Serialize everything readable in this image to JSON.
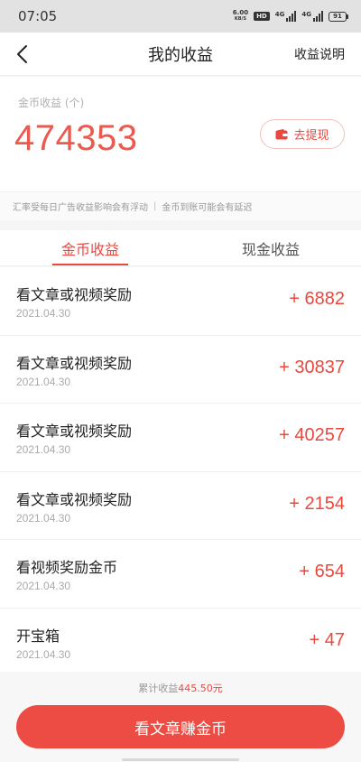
{
  "status_bar": {
    "time": "07:05",
    "net_speed_value": "6.00",
    "net_speed_unit": "KB/S",
    "hd_badge": "HD",
    "signal_1_label": "4G",
    "signal_2_label": "4G",
    "battery_level": "91"
  },
  "header": {
    "title": "我的收益",
    "right_link": "收益说明"
  },
  "balance": {
    "label": "金币收益 (个)",
    "value": "474353",
    "withdraw_label": "去提现"
  },
  "notice": {
    "part1": "汇率受每日广告收益影响会有浮动",
    "separator": "|",
    "part2": "金币到账可能会有延迟"
  },
  "tabs": [
    {
      "label": "金币收益",
      "active": true
    },
    {
      "label": "现金收益",
      "active": false
    }
  ],
  "records": [
    {
      "title": "看文章或视频奖励",
      "date": "2021.04.30",
      "amount": "+ 6882"
    },
    {
      "title": "看文章或视频奖励",
      "date": "2021.04.30",
      "amount": "+ 30837"
    },
    {
      "title": "看文章或视频奖励",
      "date": "2021.04.30",
      "amount": "+ 40257"
    },
    {
      "title": "看文章或视频奖励",
      "date": "2021.04.30",
      "amount": "+ 2154"
    },
    {
      "title": "看视频奖励金币",
      "date": "2021.04.30",
      "amount": "+ 654"
    },
    {
      "title": "开宝箱",
      "date": "2021.04.30",
      "amount": "+ 47"
    }
  ],
  "footer": {
    "total_label": "累计收益",
    "total_value": "445.50元",
    "main_button": "看文章赚金币"
  },
  "colors": {
    "accent": "#e8493f",
    "button": "#ec4c43"
  }
}
